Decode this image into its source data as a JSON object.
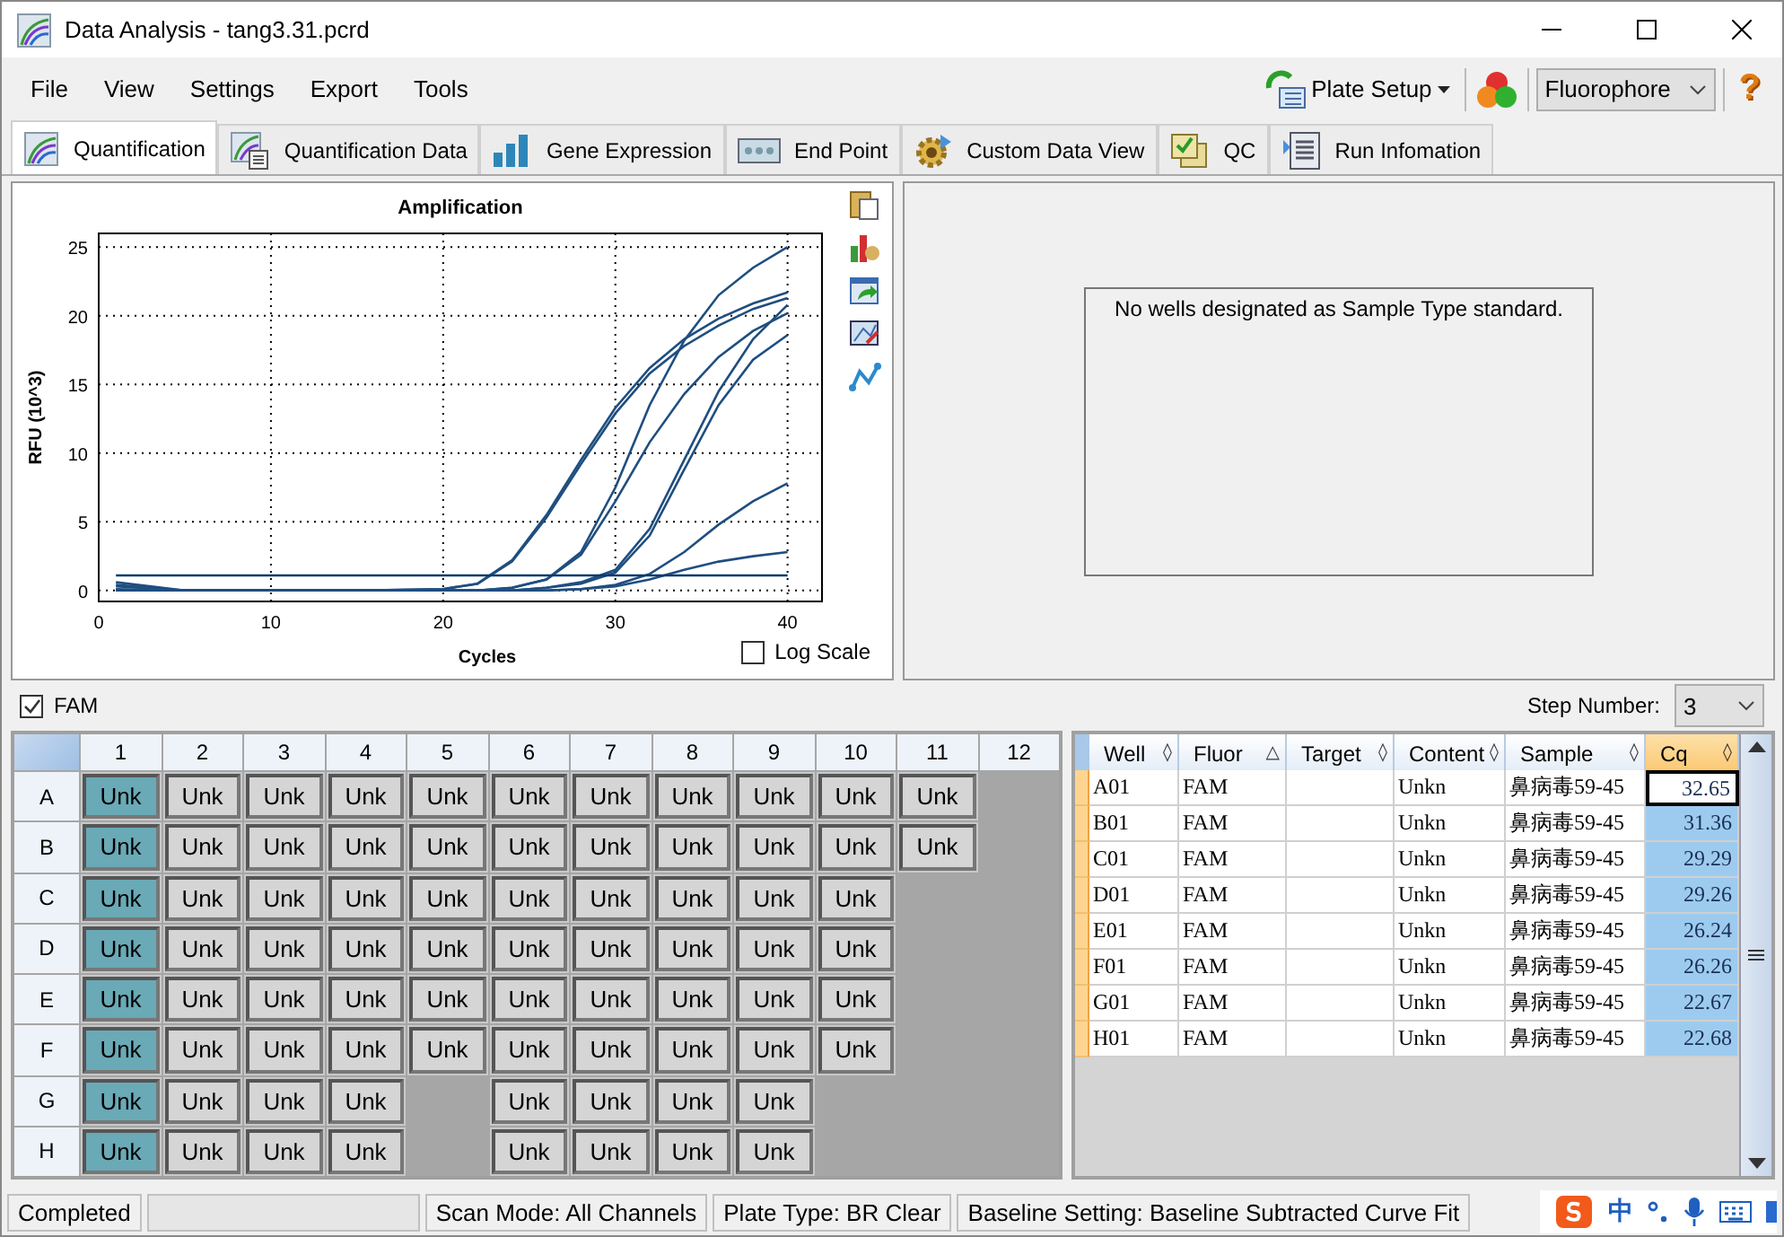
{
  "window": {
    "title": "Data Analysis - tang3.31.pcrd"
  },
  "menu": [
    "File",
    "View",
    "Settings",
    "Export",
    "Tools"
  ],
  "toolbar": {
    "plate_setup": "Plate Setup",
    "fluorophore": "Fluorophore",
    "help": "?"
  },
  "tabs": [
    {
      "label": "Quantification",
      "selected": true
    },
    {
      "label": "Quantification Data",
      "selected": false
    },
    {
      "label": "Gene Expression",
      "selected": false
    },
    {
      "label": "End Point",
      "selected": false
    },
    {
      "label": "Custom Data View",
      "selected": false
    },
    {
      "label": "QC",
      "selected": false
    },
    {
      "label": "Run Infomation",
      "selected": false
    }
  ],
  "amplification": {
    "log_scale": {
      "label": "Log Scale",
      "checked": false
    },
    "chart_data": {
      "type": "line",
      "title": "Amplification",
      "xlabel": "Cycles",
      "ylabel": "RFU (10^3)",
      "grid": true,
      "x": [
        1,
        5,
        10,
        15,
        20,
        22,
        24,
        26,
        28,
        30,
        32,
        34,
        36,
        38,
        40
      ],
      "xlim": [
        0,
        42
      ],
      "ylim": [
        -0.8,
        26
      ],
      "xticks": [
        0,
        10,
        20,
        30,
        40
      ],
      "yticks": [
        0,
        5,
        10,
        15,
        20,
        25
      ],
      "series": [
        {
          "color": "#1f4e80",
          "values": [
            0,
            0,
            0,
            0,
            0.1,
            0.5,
            2.2,
            5.5,
            9.5,
            13.3,
            16.2,
            18.3,
            19.8,
            20.9,
            21.7
          ]
        },
        {
          "color": "#1f4e80",
          "values": [
            0.3,
            0,
            0,
            0,
            0.1,
            0.5,
            2.1,
            5.3,
            9.2,
            12.9,
            15.8,
            17.8,
            19.3,
            20.5,
            21.3
          ]
        },
        {
          "color": "#1f4e80",
          "values": [
            0,
            0,
            0,
            0,
            0,
            0,
            0.2,
            0.8,
            2.8,
            7.5,
            13.5,
            18.2,
            21.5,
            23.5,
            25
          ]
        },
        {
          "color": "#1f4e80",
          "values": [
            0,
            0,
            0,
            0,
            0,
            0,
            0.2,
            0.8,
            2.6,
            6.5,
            10.8,
            14.3,
            17,
            18.9,
            20.2
          ]
        },
        {
          "color": "#1f4e80",
          "values": [
            0.6,
            0,
            0,
            0,
            0,
            0,
            0,
            0.2,
            0.6,
            1.5,
            4.5,
            9.5,
            14.5,
            18.3,
            20.8
          ]
        },
        {
          "color": "#1f4e80",
          "values": [
            0.4,
            0,
            0,
            0,
            0,
            0,
            0,
            0.2,
            0.5,
            1.3,
            4,
            8.8,
            13.5,
            16.8,
            18.6
          ]
        },
        {
          "color": "#1f4e80",
          "values": [
            0,
            0,
            0,
            0,
            0,
            0,
            0,
            0,
            0.1,
            0.4,
            1.2,
            2.8,
            4.8,
            6.5,
            7.8
          ]
        },
        {
          "color": "#1f4e80",
          "values": [
            0.1,
            0,
            0,
            0,
            0,
            0,
            0,
            0,
            0.1,
            0.3,
            0.8,
            1.5,
            2.1,
            2.5,
            2.8
          ]
        },
        {
          "color": "#0b3a6e",
          "values": [
            1.1,
            1.1,
            1.1,
            1.1,
            1.1,
            1.1,
            1.1,
            1.1,
            1.1,
            1.1,
            1.1,
            1.1,
            1.1,
            1.1,
            1.1
          ]
        }
      ]
    }
  },
  "standard_curve": {
    "message": "No wells designated as Sample Type standard."
  },
  "fluor_filter": {
    "label": "FAM",
    "checked": true
  },
  "step": {
    "label": "Step Number:",
    "value": "3"
  },
  "plate": {
    "columns": [
      "1",
      "2",
      "3",
      "4",
      "5",
      "6",
      "7",
      "8",
      "9",
      "10",
      "11",
      "12"
    ],
    "rows": [
      {
        "label": "A",
        "wells": [
          {
            "kind": "sample",
            "text": "Unk",
            "selected": true
          },
          {
            "kind": "sample",
            "text": "Unk",
            "selected": false
          },
          {
            "kind": "sample",
            "text": "Unk",
            "selected": false
          },
          {
            "kind": "sample",
            "text": "Unk",
            "selected": false
          },
          {
            "kind": "sample",
            "text": "Unk",
            "selected": false
          },
          {
            "kind": "sample",
            "text": "Unk",
            "selected": false
          },
          {
            "kind": "sample",
            "text": "Unk",
            "selected": false
          },
          {
            "kind": "sample",
            "text": "Unk",
            "selected": false
          },
          {
            "kind": "sample",
            "text": "Unk",
            "selected": false
          },
          {
            "kind": "sample",
            "text": "Unk",
            "selected": false
          },
          {
            "kind": "sample",
            "text": "Unk",
            "selected": false
          },
          {
            "kind": "empty"
          }
        ]
      },
      {
        "label": "B",
        "wells": [
          {
            "kind": "sample",
            "text": "Unk",
            "selected": true
          },
          {
            "kind": "sample",
            "text": "Unk",
            "selected": false
          },
          {
            "kind": "sample",
            "text": "Unk",
            "selected": false
          },
          {
            "kind": "sample",
            "text": "Unk",
            "selected": false
          },
          {
            "kind": "sample",
            "text": "Unk",
            "selected": false
          },
          {
            "kind": "sample",
            "text": "Unk",
            "selected": false
          },
          {
            "kind": "sample",
            "text": "Unk",
            "selected": false
          },
          {
            "kind": "sample",
            "text": "Unk",
            "selected": false
          },
          {
            "kind": "sample",
            "text": "Unk",
            "selected": false
          },
          {
            "kind": "sample",
            "text": "Unk",
            "selected": false
          },
          {
            "kind": "sample",
            "text": "Unk",
            "selected": false
          },
          {
            "kind": "empty"
          }
        ]
      },
      {
        "label": "C",
        "wells": [
          {
            "kind": "sample",
            "text": "Unk",
            "selected": true
          },
          {
            "kind": "sample",
            "text": "Unk",
            "selected": false
          },
          {
            "kind": "sample",
            "text": "Unk",
            "selected": false
          },
          {
            "kind": "sample",
            "text": "Unk",
            "selected": false
          },
          {
            "kind": "sample",
            "text": "Unk",
            "selected": false
          },
          {
            "kind": "sample",
            "text": "Unk",
            "selected": false
          },
          {
            "kind": "sample",
            "text": "Unk",
            "selected": false
          },
          {
            "kind": "sample",
            "text": "Unk",
            "selected": false
          },
          {
            "kind": "sample",
            "text": "Unk",
            "selected": false
          },
          {
            "kind": "sample",
            "text": "Unk",
            "selected": false
          },
          {
            "kind": "empty"
          },
          {
            "kind": "empty"
          }
        ]
      },
      {
        "label": "D",
        "wells": [
          {
            "kind": "sample",
            "text": "Unk",
            "selected": true
          },
          {
            "kind": "sample",
            "text": "Unk",
            "selected": false
          },
          {
            "kind": "sample",
            "text": "Unk",
            "selected": false
          },
          {
            "kind": "sample",
            "text": "Unk",
            "selected": false
          },
          {
            "kind": "sample",
            "text": "Unk",
            "selected": false
          },
          {
            "kind": "sample",
            "text": "Unk",
            "selected": false
          },
          {
            "kind": "sample",
            "text": "Unk",
            "selected": false
          },
          {
            "kind": "sample",
            "text": "Unk",
            "selected": false
          },
          {
            "kind": "sample",
            "text": "Unk",
            "selected": false
          },
          {
            "kind": "sample",
            "text": "Unk",
            "selected": false
          },
          {
            "kind": "empty"
          },
          {
            "kind": "empty"
          }
        ]
      },
      {
        "label": "E",
        "wells": [
          {
            "kind": "sample",
            "text": "Unk",
            "selected": true
          },
          {
            "kind": "sample",
            "text": "Unk",
            "selected": false
          },
          {
            "kind": "sample",
            "text": "Unk",
            "selected": false
          },
          {
            "kind": "sample",
            "text": "Unk",
            "selected": false
          },
          {
            "kind": "sample",
            "text": "Unk",
            "selected": false
          },
          {
            "kind": "sample",
            "text": "Unk",
            "selected": false
          },
          {
            "kind": "sample",
            "text": "Unk",
            "selected": false
          },
          {
            "kind": "sample",
            "text": "Unk",
            "selected": false
          },
          {
            "kind": "sample",
            "text": "Unk",
            "selected": false
          },
          {
            "kind": "sample",
            "text": "Unk",
            "selected": false
          },
          {
            "kind": "empty"
          },
          {
            "kind": "empty"
          }
        ]
      },
      {
        "label": "F",
        "wells": [
          {
            "kind": "sample",
            "text": "Unk",
            "selected": true
          },
          {
            "kind": "sample",
            "text": "Unk",
            "selected": false
          },
          {
            "kind": "sample",
            "text": "Unk",
            "selected": false
          },
          {
            "kind": "sample",
            "text": "Unk",
            "selected": false
          },
          {
            "kind": "sample",
            "text": "Unk",
            "selected": false
          },
          {
            "kind": "sample",
            "text": "Unk",
            "selected": false
          },
          {
            "kind": "sample",
            "text": "Unk",
            "selected": false
          },
          {
            "kind": "sample",
            "text": "Unk",
            "selected": false
          },
          {
            "kind": "sample",
            "text": "Unk",
            "selected": false
          },
          {
            "kind": "sample",
            "text": "Unk",
            "selected": false
          },
          {
            "kind": "empty"
          },
          {
            "kind": "empty"
          }
        ]
      },
      {
        "label": "G",
        "wells": [
          {
            "kind": "sample",
            "text": "Unk",
            "selected": true
          },
          {
            "kind": "sample",
            "text": "Unk",
            "selected": false
          },
          {
            "kind": "sample",
            "text": "Unk",
            "selected": false
          },
          {
            "kind": "sample",
            "text": "Unk",
            "selected": false
          },
          {
            "kind": "empty"
          },
          {
            "kind": "sample",
            "text": "Unk",
            "selected": false
          },
          {
            "kind": "sample",
            "text": "Unk",
            "selected": false
          },
          {
            "kind": "sample",
            "text": "Unk",
            "selected": false
          },
          {
            "kind": "sample",
            "text": "Unk",
            "selected": false
          },
          {
            "kind": "empty"
          },
          {
            "kind": "empty"
          },
          {
            "kind": "empty"
          }
        ]
      },
      {
        "label": "H",
        "wells": [
          {
            "kind": "sample",
            "text": "Unk",
            "selected": true
          },
          {
            "kind": "sample",
            "text": "Unk",
            "selected": false
          },
          {
            "kind": "sample",
            "text": "Unk",
            "selected": false
          },
          {
            "kind": "sample",
            "text": "Unk",
            "selected": false
          },
          {
            "kind": "empty"
          },
          {
            "kind": "sample",
            "text": "Unk",
            "selected": false
          },
          {
            "kind": "sample",
            "text": "Unk",
            "selected": false
          },
          {
            "kind": "sample",
            "text": "Unk",
            "selected": false
          },
          {
            "kind": "sample",
            "text": "Unk",
            "selected": false
          },
          {
            "kind": "empty"
          },
          {
            "kind": "empty"
          },
          {
            "kind": "empty"
          }
        ]
      }
    ]
  },
  "table": {
    "columns": [
      {
        "label": "Well",
        "sort_mark": "◊",
        "selected": false
      },
      {
        "label": "Fluor",
        "sort_mark": "△",
        "selected": false
      },
      {
        "label": "Target",
        "sort_mark": "◊",
        "selected": false
      },
      {
        "label": "Content",
        "sort_mark": "◊",
        "selected": false
      },
      {
        "label": "Sample",
        "sort_mark": "◊",
        "selected": false
      },
      {
        "label": "Cq",
        "sort_mark": "◊",
        "selected": true
      }
    ],
    "rows": [
      {
        "well": "A01",
        "fluor": "FAM",
        "content": "Unkn",
        "sample": "鼻病毒59-45",
        "cq": "32.65",
        "focused": true
      },
      {
        "well": "B01",
        "fluor": "FAM",
        "content": "Unkn",
        "sample": "鼻病毒59-45",
        "cq": "31.36",
        "focused": false
      },
      {
        "well": "C01",
        "fluor": "FAM",
        "content": "Unkn",
        "sample": "鼻病毒59-45",
        "cq": "29.29",
        "focused": false
      },
      {
        "well": "D01",
        "fluor": "FAM",
        "content": "Unkn",
        "sample": "鼻病毒59-45",
        "cq": "29.26",
        "focused": false
      },
      {
        "well": "E01",
        "fluor": "FAM",
        "content": "Unkn",
        "sample": "鼻病毒59-45",
        "cq": "26.24",
        "focused": false
      },
      {
        "well": "F01",
        "fluor": "FAM",
        "content": "Unkn",
        "sample": "鼻病毒59-45",
        "cq": "26.26",
        "focused": false
      },
      {
        "well": "G01",
        "fluor": "FAM",
        "content": "Unkn",
        "sample": "鼻病毒59-45",
        "cq": "22.67",
        "focused": false
      },
      {
        "well": "H01",
        "fluor": "FAM",
        "content": "Unkn",
        "sample": "鼻病毒59-45",
        "cq": "22.68",
        "focused": false
      }
    ]
  },
  "status_bar": {
    "status": "Completed",
    "progress": {
      "level": 0
    },
    "scan_mode": "Scan Mode: All Channels",
    "plate_type": "Plate Type: BR Clear",
    "baseline": "Baseline Setting: Baseline Subtracted Curve Fit"
  },
  "ime_tray": {
    "mode": "中"
  }
}
